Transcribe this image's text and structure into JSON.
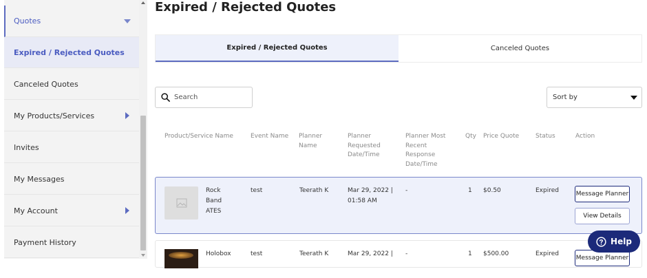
{
  "sidebar": {
    "items": [
      {
        "label": "Quotes"
      },
      {
        "label": "Expired / Rejected Quotes"
      },
      {
        "label": "Canceled Quotes"
      },
      {
        "label": "My Products/Services"
      },
      {
        "label": "Invites"
      },
      {
        "label": "My Messages"
      },
      {
        "label": "My Account"
      },
      {
        "label": "Payment History"
      }
    ]
  },
  "page": {
    "title": "Expired / Rejected Quotes"
  },
  "tabs": [
    {
      "label": "Expired / Rejected Quotes",
      "active": true
    },
    {
      "label": "Canceled Quotes",
      "active": false
    }
  ],
  "search": {
    "placeholder": "Search"
  },
  "sort": {
    "label": "Sort by"
  },
  "table": {
    "headers": {
      "product": "Product/Service Name",
      "event": "Event Name",
      "planner": "Planner\nName",
      "requested": "Planner\nRequested\nDate/Time",
      "response": "Planner Most\nRecent\nResponse\nDate/Time",
      "qty": "Qty",
      "price": "Price Quote",
      "status": "Status",
      "action": "Action"
    },
    "rows": [
      {
        "product": "Rock\nBand\nATES",
        "event": "test",
        "planner": "Teerath K",
        "requested": "Mar 29, 2022 |\n01:58 AM",
        "response": "-",
        "qty": "1",
        "price": "$0.50",
        "status": "Expired",
        "message_btn": "Message Planner",
        "details_btn": "View Details"
      },
      {
        "product": "Holobox",
        "event": "test",
        "planner": "Teerath K",
        "requested": "Mar 29, 2022 |",
        "response": "-",
        "qty": "1",
        "price": "$500.00",
        "status": "Expired",
        "message_btn": "Message Planner"
      }
    ]
  },
  "help": {
    "label": "Help"
  },
  "colors": {
    "accent": "#5c6bc0",
    "navy": "#1c2a7a",
    "active_bg": "#eef1fb"
  }
}
